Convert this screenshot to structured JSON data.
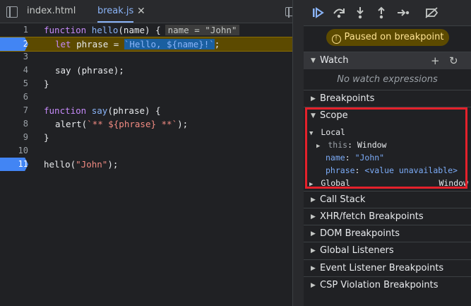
{
  "tabs": [
    {
      "label": "index.html",
      "active": false
    },
    {
      "label": "break.js",
      "active": true
    }
  ],
  "tab_close_glyph": "✕",
  "code_lines": [
    {
      "num": "1",
      "breakpoint": false
    },
    {
      "num": "2",
      "breakpoint": true
    },
    {
      "num": "3",
      "breakpoint": false
    },
    {
      "num": "4",
      "breakpoint": false
    },
    {
      "num": "5",
      "breakpoint": false
    },
    {
      "num": "6",
      "breakpoint": false
    },
    {
      "num": "7",
      "breakpoint": false
    },
    {
      "num": "8",
      "breakpoint": false
    },
    {
      "num": "9",
      "breakpoint": false
    },
    {
      "num": "10",
      "breakpoint": false
    },
    {
      "num": "11",
      "breakpoint": true
    }
  ],
  "code": {
    "l1_kw": "function",
    "l1_fn": "hello",
    "l1_rest": "(name) {",
    "l1_inline": "name = \"John\"",
    "l2_kw": "let",
    "l2_mid": " phrase = ",
    "l2_str": "`Hello, ${name}!`",
    "l2_end": ";",
    "l4": "say (phrase);",
    "l5": "}",
    "l7_kw": "function",
    "l7_fn": "say",
    "l7_rest": "(phrase) {",
    "l8_a": "alert(",
    "l8_str": "`** ${phrase} **`",
    "l8_end": ");",
    "l9": "}",
    "l11_a": "hello(",
    "l11_str": "\"John\"",
    "l11_end": ");"
  },
  "toolbar": {
    "icons": [
      "resume-icon",
      "step-over-icon",
      "step-into-icon",
      "step-out-icon",
      "step-icon",
      "deactivate-breakpoints-icon"
    ]
  },
  "paused_label": "Paused on breakpoint",
  "sections": {
    "watch": "Watch",
    "watch_empty": "No watch expressions",
    "breakpoints": "Breakpoints",
    "scope": "Scope",
    "call_stack": "Call Stack",
    "xhr": "XHR/fetch Breakpoints",
    "dom": "DOM Breakpoints",
    "global_listeners": "Global Listeners",
    "event_listener": "Event Listener Breakpoints",
    "csp": "CSP Violation Breakpoints"
  },
  "scope": {
    "local_label": "Local",
    "this_name": "this",
    "this_value": "Window",
    "name_name": "name",
    "name_value": "\"John\"",
    "phrase_name": "phrase",
    "phrase_value": "<value unavailable>",
    "global_label": "Global",
    "global_value": "Window"
  },
  "colors": {
    "accent": "#8ab4f8",
    "breakpoint": "#4285f4",
    "paused_line": "#5c4a00",
    "highlight_box": "#e4212b"
  }
}
